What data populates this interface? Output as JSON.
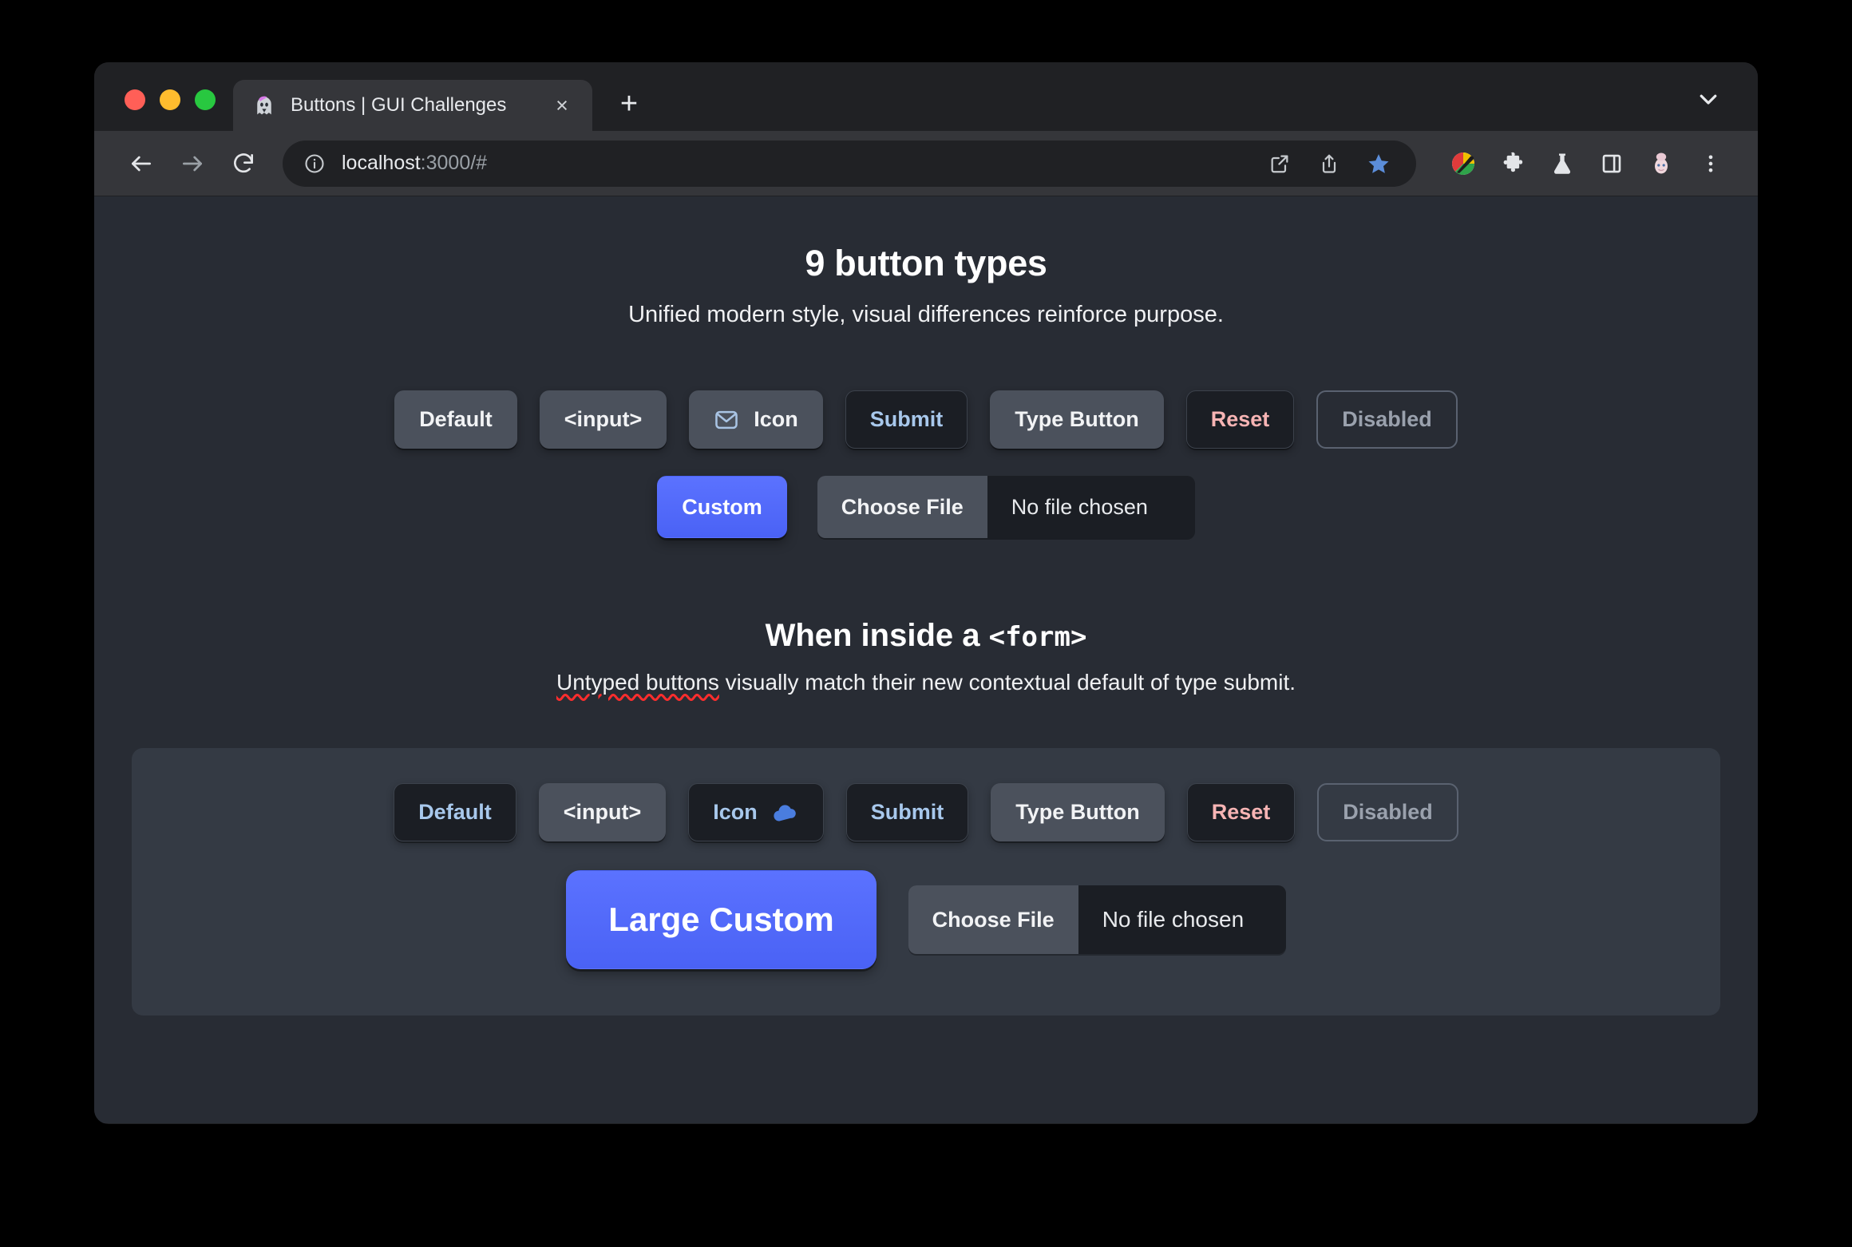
{
  "browser": {
    "tab": {
      "favicon": "ghost-icon",
      "title": "Buttons | GUI Challenges",
      "close_label": "×"
    },
    "new_tab_label": "+",
    "toolbar": {
      "back_icon": "back-arrow-icon",
      "forward_icon": "forward-arrow-icon",
      "reload_icon": "reload-icon",
      "info_icon": "info-circle-icon",
      "url_host": "localhost",
      "url_rest": ":3000/#",
      "popout_icon": "open-in-new-icon",
      "share_icon": "share-icon",
      "bookmark_icon": "star-filled-icon",
      "ext_palette_icon": "color-palette-extension-icon",
      "ext_puzzle_icon": "extensions-puzzle-icon",
      "ext_flask_icon": "lab-flask-icon",
      "ext_panel_icon": "side-panel-icon",
      "profile_icon": "profile-avatar-icon",
      "menu_icon": "three-dots-menu-icon"
    },
    "tabstrip_chevron_icon": "chevron-down-icon"
  },
  "page": {
    "title": "9 button types",
    "subtitle": "Unified modern style, visual differences reinforce purpose.",
    "section_title_prefix": "When inside a ",
    "section_title_mono": "<form>",
    "section_sub_underlined": "Untyped buttons",
    "section_sub_rest": " visually match their new contextual default of type submit.",
    "buttons_row1": [
      {
        "label": "Default",
        "style": "default",
        "icon": null
      },
      {
        "label": "<input>",
        "style": "default",
        "icon": null
      },
      {
        "label": "Icon",
        "style": "default",
        "icon": "envelope-icon",
        "icon_side": "left"
      },
      {
        "label": "Submit",
        "style": "submit",
        "icon": null
      },
      {
        "label": "Type Button",
        "style": "default",
        "icon": null
      },
      {
        "label": "Reset",
        "style": "reset",
        "icon": null
      },
      {
        "label": "Disabled",
        "style": "disabled",
        "icon": null
      }
    ],
    "buttons_row2": {
      "custom_label": "Custom",
      "file_button_label": "Choose File",
      "file_status_label": "No file chosen"
    },
    "form_buttons_row1": [
      {
        "label": "Default",
        "style": "submit",
        "icon": null
      },
      {
        "label": "<input>",
        "style": "default",
        "icon": null
      },
      {
        "label": "Icon",
        "style": "submit",
        "icon": "cloud-icon",
        "icon_side": "right"
      },
      {
        "label": "Submit",
        "style": "submit",
        "icon": null
      },
      {
        "label": "Type Button",
        "style": "default",
        "icon": null
      },
      {
        "label": "Reset",
        "style": "reset",
        "icon": null
      },
      {
        "label": "Disabled",
        "style": "disabled",
        "icon": null
      }
    ],
    "form_buttons_row2": {
      "custom_label": "Large Custom",
      "file_button_label": "Choose File",
      "file_status_label": "No file chosen"
    }
  },
  "colors": {
    "page_bg": "#282c34",
    "panel_bg": "#343a44",
    "button_bg": "#4b515c",
    "button_dark_bg": "#1b1e24",
    "accent_blue": "#a8c8ec",
    "accent_red": "#f7b4b4",
    "custom_blue": "#5b72ff",
    "icon_blue": "#4a7ddf"
  }
}
